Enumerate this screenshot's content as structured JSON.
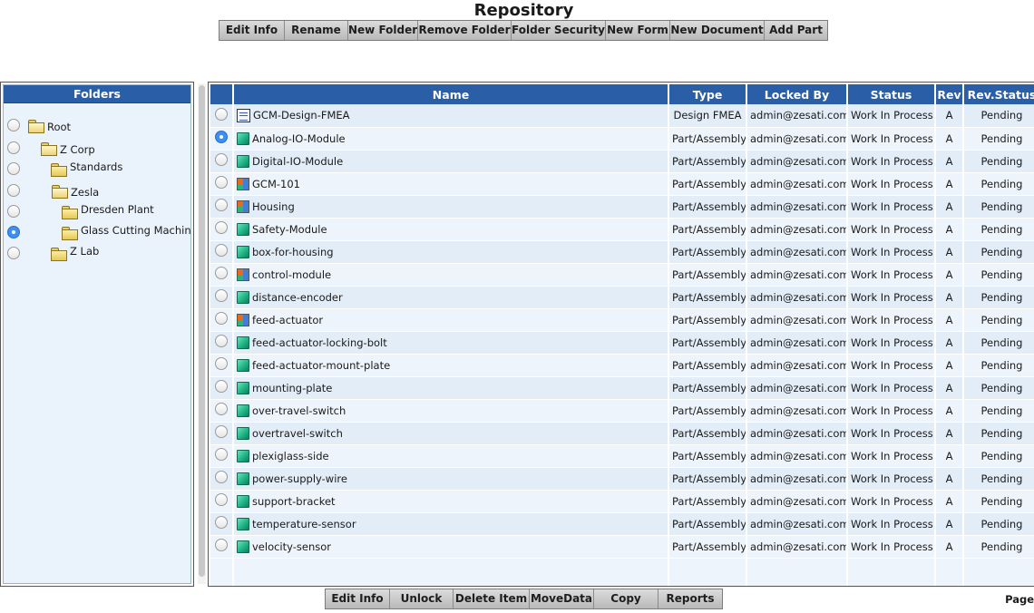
{
  "page": {
    "title": "Repository",
    "pager_label": "Page"
  },
  "toolbar_top": [
    "Edit Info",
    "Rename",
    "New Folder",
    "Remove Folder",
    "Folder Security",
    "New Form",
    "New Document",
    "Add Part"
  ],
  "toolbar_bottom": [
    "Edit Info",
    "Unlock",
    "Delete Item",
    "MoveData",
    "Copy",
    "Reports"
  ],
  "folders": {
    "header": "Folders",
    "items": [
      {
        "label": "Root",
        "selected": false,
        "icon": "folder-open-icon"
      },
      {
        "label": "Z Corp",
        "selected": false,
        "icon": "folder-open-icon"
      },
      {
        "label": "Standards",
        "selected": false,
        "icon": "folder-icon"
      },
      {
        "label": "Zesla",
        "selected": false,
        "icon": "folder-open-icon"
      },
      {
        "label": "Dresden Plant",
        "selected": false,
        "icon": "folder-icon"
      },
      {
        "label": "Glass Cutting Machine",
        "selected": true,
        "icon": "folder-icon"
      },
      {
        "label": "Z Lab",
        "selected": false,
        "icon": "folder-icon"
      }
    ]
  },
  "table": {
    "columns": [
      "Name",
      "Type",
      "Locked By",
      "Status",
      "Rev",
      "Rev.Status"
    ],
    "rows": [
      {
        "name": "GCM-Design-FMEA",
        "icon": "document-icon",
        "type": "Design FMEA",
        "locked_by": "admin@zesati.com",
        "status": "Work In Process",
        "rev": "A",
        "rev_status": "Pending",
        "selected": false
      },
      {
        "name": "Analog-IO-Module",
        "icon": "part-icon",
        "type": "Part/Assembly",
        "locked_by": "admin@zesati.com",
        "status": "Work In Process",
        "rev": "A",
        "rev_status": "Pending",
        "selected": true
      },
      {
        "name": "Digital-IO-Module",
        "icon": "part-icon",
        "type": "Part/Assembly",
        "locked_by": "admin@zesati.com",
        "status": "Work In Process",
        "rev": "A",
        "rev_status": "Pending",
        "selected": false
      },
      {
        "name": "GCM-101",
        "icon": "assembly-icon",
        "type": "Part/Assembly",
        "locked_by": "admin@zesati.com",
        "status": "Work In Process",
        "rev": "A",
        "rev_status": "Pending",
        "selected": false
      },
      {
        "name": "Housing",
        "icon": "assembly-icon",
        "type": "Part/Assembly",
        "locked_by": "admin@zesati.com",
        "status": "Work In Process",
        "rev": "A",
        "rev_status": "Pending",
        "selected": false
      },
      {
        "name": "Safety-Module",
        "icon": "part-icon",
        "type": "Part/Assembly",
        "locked_by": "admin@zesati.com",
        "status": "Work In Process",
        "rev": "A",
        "rev_status": "Pending",
        "selected": false
      },
      {
        "name": "box-for-housing",
        "icon": "part-icon",
        "type": "Part/Assembly",
        "locked_by": "admin@zesati.com",
        "status": "Work In Process",
        "rev": "A",
        "rev_status": "Pending",
        "selected": false
      },
      {
        "name": "control-module",
        "icon": "assembly-icon",
        "type": "Part/Assembly",
        "locked_by": "admin@zesati.com",
        "status": "Work In Process",
        "rev": "A",
        "rev_status": "Pending",
        "selected": false
      },
      {
        "name": "distance-encoder",
        "icon": "part-icon",
        "type": "Part/Assembly",
        "locked_by": "admin@zesati.com",
        "status": "Work In Process",
        "rev": "A",
        "rev_status": "Pending",
        "selected": false
      },
      {
        "name": "feed-actuator",
        "icon": "assembly-icon",
        "type": "Part/Assembly",
        "locked_by": "admin@zesati.com",
        "status": "Work In Process",
        "rev": "A",
        "rev_status": "Pending",
        "selected": false
      },
      {
        "name": "feed-actuator-locking-bolt",
        "icon": "part-icon",
        "type": "Part/Assembly",
        "locked_by": "admin@zesati.com",
        "status": "Work In Process",
        "rev": "A",
        "rev_status": "Pending",
        "selected": false
      },
      {
        "name": "feed-actuator-mount-plate",
        "icon": "part-icon",
        "type": "Part/Assembly",
        "locked_by": "admin@zesati.com",
        "status": "Work In Process",
        "rev": "A",
        "rev_status": "Pending",
        "selected": false
      },
      {
        "name": "mounting-plate",
        "icon": "part-icon",
        "type": "Part/Assembly",
        "locked_by": "admin@zesati.com",
        "status": "Work In Process",
        "rev": "A",
        "rev_status": "Pending",
        "selected": false
      },
      {
        "name": "over-travel-switch",
        "icon": "part-icon",
        "type": "Part/Assembly",
        "locked_by": "admin@zesati.com",
        "status": "Work In Process",
        "rev": "A",
        "rev_status": "Pending",
        "selected": false
      },
      {
        "name": "overtravel-switch",
        "icon": "part-icon",
        "type": "Part/Assembly",
        "locked_by": "admin@zesati.com",
        "status": "Work In Process",
        "rev": "A",
        "rev_status": "Pending",
        "selected": false
      },
      {
        "name": "plexiglass-side",
        "icon": "part-icon",
        "type": "Part/Assembly",
        "locked_by": "admin@zesati.com",
        "status": "Work In Process",
        "rev": "A",
        "rev_status": "Pending",
        "selected": false
      },
      {
        "name": "power-supply-wire",
        "icon": "part-icon",
        "type": "Part/Assembly",
        "locked_by": "admin@zesati.com",
        "status": "Work In Process",
        "rev": "A",
        "rev_status": "Pending",
        "selected": false
      },
      {
        "name": "support-bracket",
        "icon": "part-icon",
        "type": "Part/Assembly",
        "locked_by": "admin@zesati.com",
        "status": "Work In Process",
        "rev": "A",
        "rev_status": "Pending",
        "selected": false
      },
      {
        "name": "temperature-sensor",
        "icon": "part-icon",
        "type": "Part/Assembly",
        "locked_by": "admin@zesati.com",
        "status": "Work In Process",
        "rev": "A",
        "rev_status": "Pending",
        "selected": false
      },
      {
        "name": "velocity-sensor",
        "icon": "part-icon",
        "type": "Part/Assembly",
        "locked_by": "admin@zesati.com",
        "status": "Work In Process",
        "rev": "A",
        "rev_status": "Pending",
        "selected": false
      }
    ]
  },
  "colors": {
    "header_blue": "#2a5ea6",
    "row_bg": "#eaf2fb",
    "radio_selected": "#3d8ff0"
  }
}
